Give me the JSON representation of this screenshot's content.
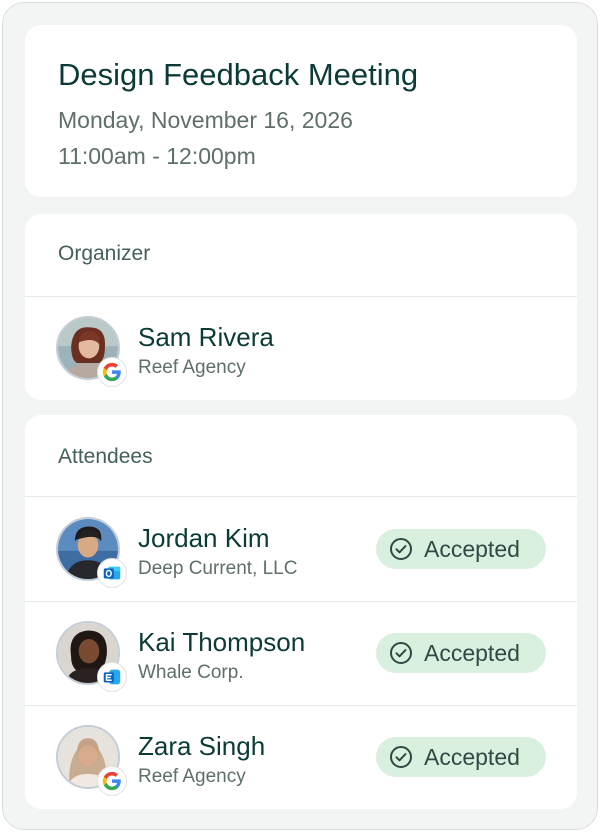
{
  "event": {
    "title": "Design Feedback Meeting",
    "date": "Monday, November 16, 2026",
    "time": "11:00am - 12:00pm"
  },
  "organizer": {
    "heading": "Organizer",
    "name": "Sam Rivera",
    "company": "Reef Agency",
    "calendar_icon": "google-icon"
  },
  "attendees": {
    "heading": "Attendees",
    "items": [
      {
        "name": "Jordan Kim",
        "company": "Deep Current, LLC",
        "calendar_icon": "outlook-icon",
        "status": "Accepted"
      },
      {
        "name": "Kai Thompson",
        "company": "Whale Corp.",
        "calendar_icon": "exchange-icon",
        "status": "Accepted"
      },
      {
        "name": "Zara Singh",
        "company": "Reef Agency",
        "calendar_icon": "google-icon",
        "status": "Accepted"
      }
    ]
  },
  "colors": {
    "title_text": "#0c3b37",
    "muted_text": "#5e6f6c",
    "accepted_bg": "#d9f0de",
    "card_bg": "#ffffff",
    "page_bg": "#f3f5f4"
  }
}
